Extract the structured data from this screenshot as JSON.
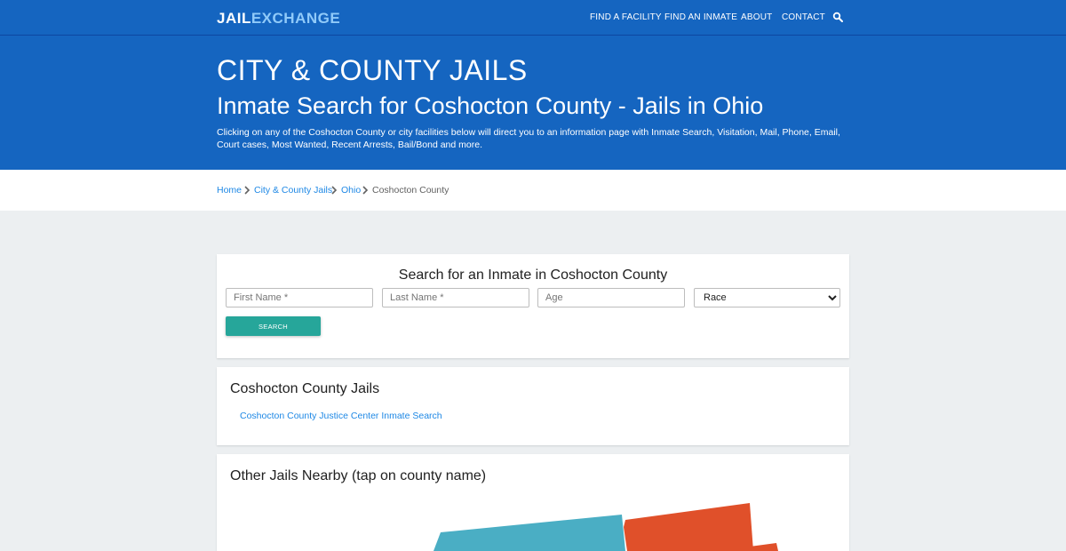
{
  "header": {
    "logo": {
      "part1": "JAIL",
      "part2": "EXCHANGE"
    },
    "nav": [
      {
        "label": "FIND A FACILITY"
      },
      {
        "label": "FIND AN INMATE"
      },
      {
        "label": "ABOUT"
      },
      {
        "label": "CONTACT"
      }
    ],
    "search_icon": "search-icon"
  },
  "hero": {
    "kicker": "CITY & COUNTY JAILS",
    "title": "Inmate Search for Coshocton County - Jails in Ohio",
    "description": "Clicking on any of the Coshocton County or city facilities below will direct you to an information page with Inmate Search, Visitation, Mail, Phone, Email, Court cases, Most Wanted, Recent Arrests, Bail/Bond and more."
  },
  "breadcrumb": [
    {
      "label": "Home"
    },
    {
      "label": "City & County Jails"
    },
    {
      "label": "Ohio"
    },
    {
      "label": "Coshocton County"
    }
  ],
  "search_form": {
    "title": "Search for an Inmate in Coshocton County",
    "first_name": {
      "value": "",
      "placeholder": "First Name *"
    },
    "last_name": {
      "value": "",
      "placeholder": "Last Name *"
    },
    "age": {
      "value": "",
      "placeholder": "Age"
    },
    "race": {
      "selected": "Race"
    },
    "button": "SEARCH"
  },
  "jails_section": {
    "title": "Coshocton County Jails",
    "items": [
      {
        "label": "Coshocton County Justice Center Inmate Search"
      }
    ]
  },
  "nearby_section": {
    "title": "Other Jails Nearby (tap on county name)",
    "map_colors": [
      "#4aaec4",
      "#e0502a"
    ]
  },
  "colors": {
    "brand_blue": "#1565c0",
    "link_blue": "#1e88e5",
    "button_teal": "#26a69a",
    "page_bg": "#eceff1"
  }
}
